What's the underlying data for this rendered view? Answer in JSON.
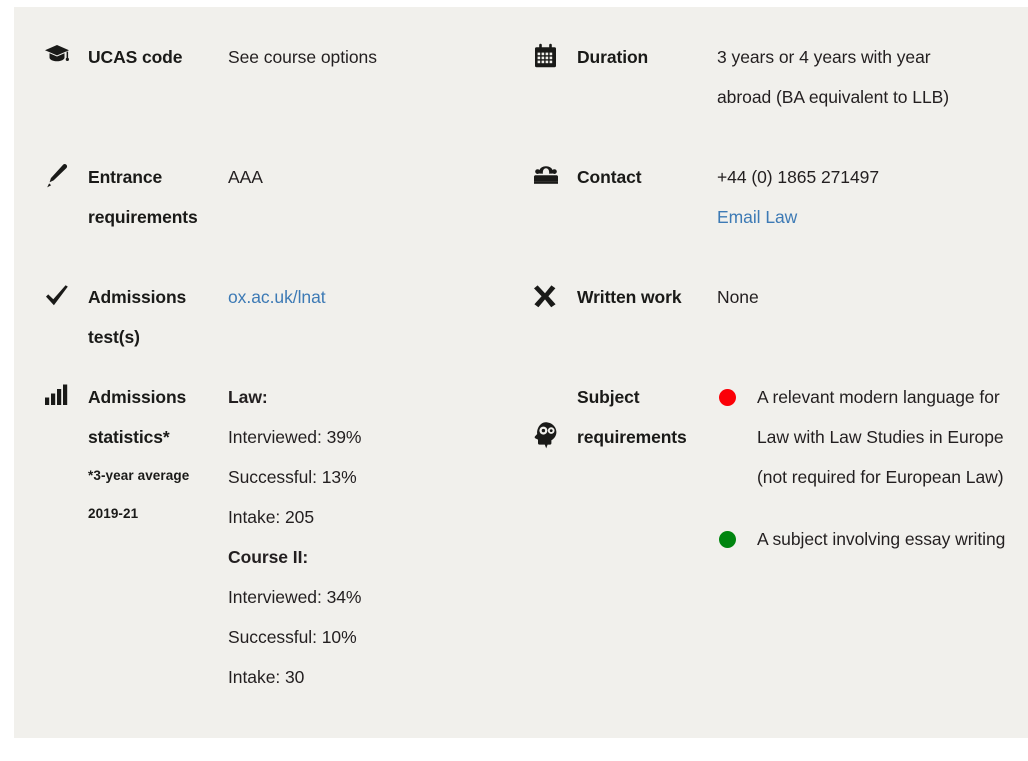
{
  "card": {
    "background_color": "#f1f0ec",
    "link_color": "#3d7ab5",
    "text_color": "#231f20"
  },
  "left_column": [
    {
      "icon": "graduation-cap-icon",
      "label": "UCAS code",
      "value": "See course options",
      "key": "ucas"
    },
    {
      "icon": "pencil-icon",
      "label": "Entrance requirements",
      "value": "AAA",
      "key": "entrance"
    },
    {
      "icon": "check-icon",
      "label": "Admissions test(s)",
      "value": "ox.ac.uk/lnat",
      "value_is_link": true,
      "key": "admissions-test"
    },
    {
      "icon": "bar-chart-icon",
      "label": "Admissions statistics*",
      "note_line_1": "*3-year average",
      "note_line_2": "2019-21",
      "key": "admissions-statistics",
      "stats": [
        {
          "heading": "Law:",
          "lines": [
            "Interviewed: 39%",
            "Successful: 13%",
            "Intake: 205"
          ]
        },
        {
          "heading": "Course II:",
          "lines": [
            "Interviewed: 34%",
            "Successful: 10%",
            "Intake: 30"
          ]
        }
      ]
    }
  ],
  "right_column": [
    {
      "icon": "calendar-icon",
      "label": "Duration",
      "value_lines": [
        "3 years or 4 years with year",
        "abroad (BA equivalent to LLB)"
      ],
      "key": "duration"
    },
    {
      "icon": "telephone-icon",
      "label": "Contact",
      "value_lines": [
        "+44 (0) 1865 271497"
      ],
      "link_text": "Email Law",
      "key": "contact"
    },
    {
      "icon": "cross-icon",
      "label": "Written work",
      "value_lines": [
        "None"
      ],
      "key": "written-work"
    },
    {
      "icon": "head-cog-icon",
      "label": "Subject requirements",
      "key": "subject-requirements",
      "bullets": [
        {
          "dot_color": "#fb0007",
          "dot_name": "red-bullet-dot",
          "text": "A relevant modern language for Law with Law Studies in Europe (not required for European Law)"
        },
        {
          "dot_color": "#00850f",
          "dot_name": "green-bullet-dot",
          "text": "A subject involving essay writing"
        }
      ]
    }
  ],
  "chart_data": {
    "type": "table",
    "title": "Admissions statistics (3-year average 2019-21)",
    "categories": [
      "Interviewed",
      "Successful",
      "Intake"
    ],
    "series": [
      {
        "name": "Law",
        "values": [
          39,
          13,
          205
        ],
        "units": [
          "%",
          "%",
          "count"
        ]
      },
      {
        "name": "Course II",
        "values": [
          34,
          10,
          30
        ],
        "units": [
          "%",
          "%",
          "count"
        ]
      }
    ]
  }
}
